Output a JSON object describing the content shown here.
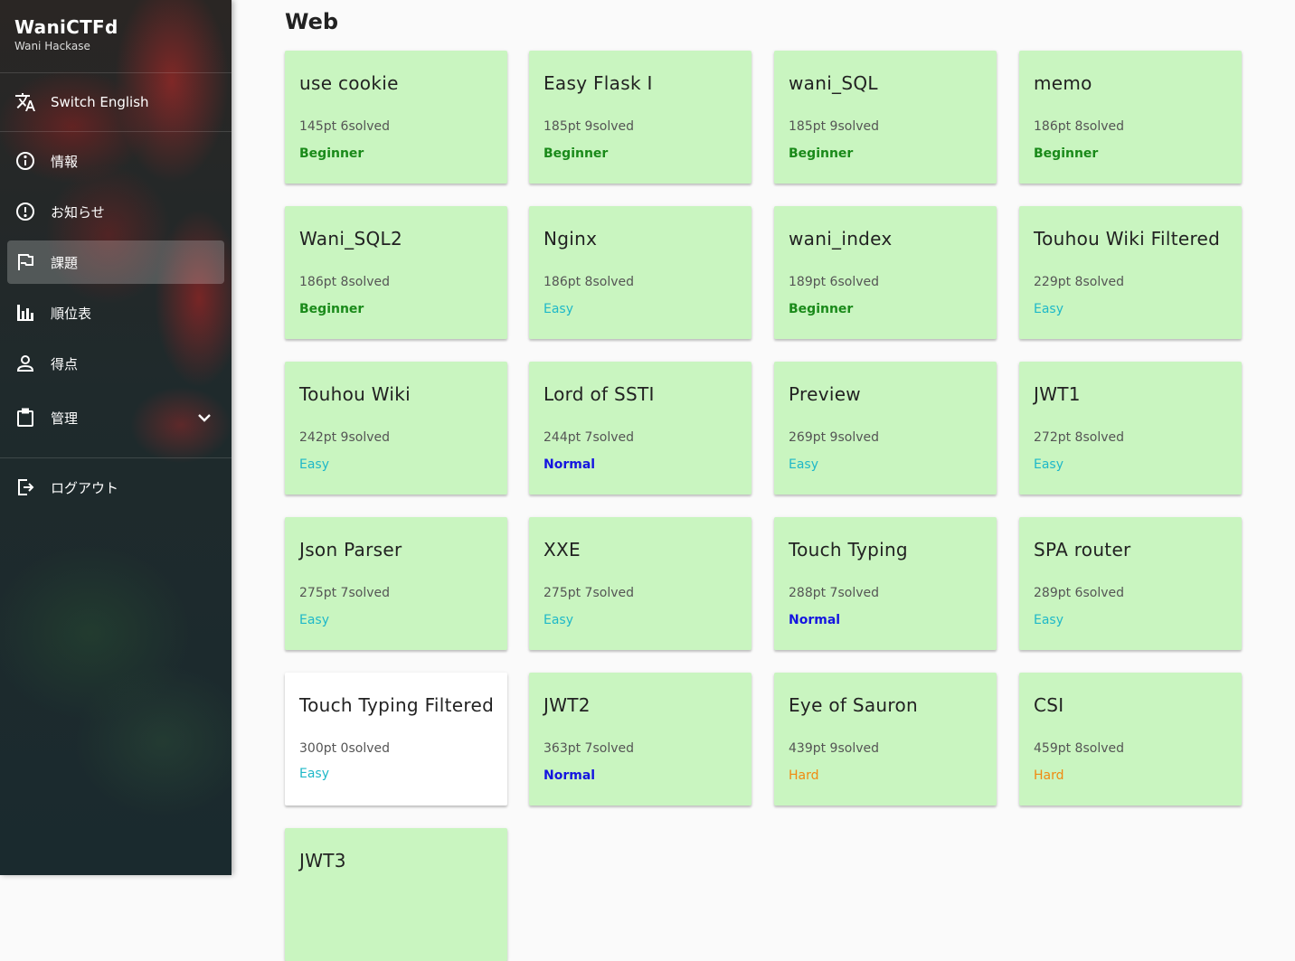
{
  "brand": {
    "title": "WaniCTFd",
    "subtitle": "Wani Hackase"
  },
  "sidebar": {
    "items": [
      {
        "label": "Switch English",
        "icon": "translate-icon"
      },
      {
        "label": "情報",
        "icon": "info-icon"
      },
      {
        "label": "お知らせ",
        "icon": "alert-circle-icon"
      },
      {
        "label": "課題",
        "icon": "flag-icon",
        "active": true
      },
      {
        "label": "順位表",
        "icon": "bar-chart-icon"
      },
      {
        "label": "得点",
        "icon": "person-icon"
      },
      {
        "label": "管理",
        "icon": "clipboard-icon",
        "expandable": true
      },
      {
        "label": "ログアウト",
        "icon": "logout-icon"
      }
    ]
  },
  "main": {
    "category": "Web",
    "challenges": [
      {
        "name": "use cookie",
        "meta": "145pt 6solved",
        "level": "Beginner",
        "solved": true
      },
      {
        "name": "Easy Flask I",
        "meta": "185pt 9solved",
        "level": "Beginner",
        "solved": true
      },
      {
        "name": "wani_SQL",
        "meta": "185pt 9solved",
        "level": "Beginner",
        "solved": true
      },
      {
        "name": "memo",
        "meta": "186pt 8solved",
        "level": "Beginner",
        "solved": true
      },
      {
        "name": "Wani_SQL2",
        "meta": "186pt 8solved",
        "level": "Beginner",
        "solved": true
      },
      {
        "name": "Nginx",
        "meta": "186pt 8solved",
        "level": "Easy",
        "solved": true
      },
      {
        "name": "wani_index",
        "meta": "189pt 6solved",
        "level": "Beginner",
        "solved": true
      },
      {
        "name": "Touhou Wiki Filtered",
        "meta": "229pt 8solved",
        "level": "Easy",
        "solved": true
      },
      {
        "name": "Touhou Wiki",
        "meta": "242pt 9solved",
        "level": "Easy",
        "solved": true
      },
      {
        "name": "Lord of SSTI",
        "meta": "244pt 7solved",
        "level": "Normal",
        "solved": true
      },
      {
        "name": "Preview",
        "meta": "269pt 9solved",
        "level": "Easy",
        "solved": true
      },
      {
        "name": "JWT1",
        "meta": "272pt 8solved",
        "level": "Easy",
        "solved": true
      },
      {
        "name": "Json Parser",
        "meta": "275pt 7solved",
        "level": "Easy",
        "solved": true
      },
      {
        "name": "XXE",
        "meta": "275pt 7solved",
        "level": "Easy",
        "solved": true
      },
      {
        "name": "Touch Typing",
        "meta": "288pt 7solved",
        "level": "Normal",
        "solved": true
      },
      {
        "name": "SPA router",
        "meta": "289pt 6solved",
        "level": "Easy",
        "solved": true
      },
      {
        "name": "Touch Typing Filtered",
        "meta": "300pt 0solved",
        "level": "Easy",
        "solved": false
      },
      {
        "name": "JWT2",
        "meta": "363pt 7solved",
        "level": "Normal",
        "solved": true
      },
      {
        "name": "Eye of Sauron",
        "meta": "439pt 9solved",
        "level": "Hard",
        "solved": true
      },
      {
        "name": "CSI",
        "meta": "459pt 8solved",
        "level": "Hard",
        "solved": true
      },
      {
        "name": "JWT3",
        "meta": "",
        "level": "",
        "solved": true
      }
    ]
  }
}
